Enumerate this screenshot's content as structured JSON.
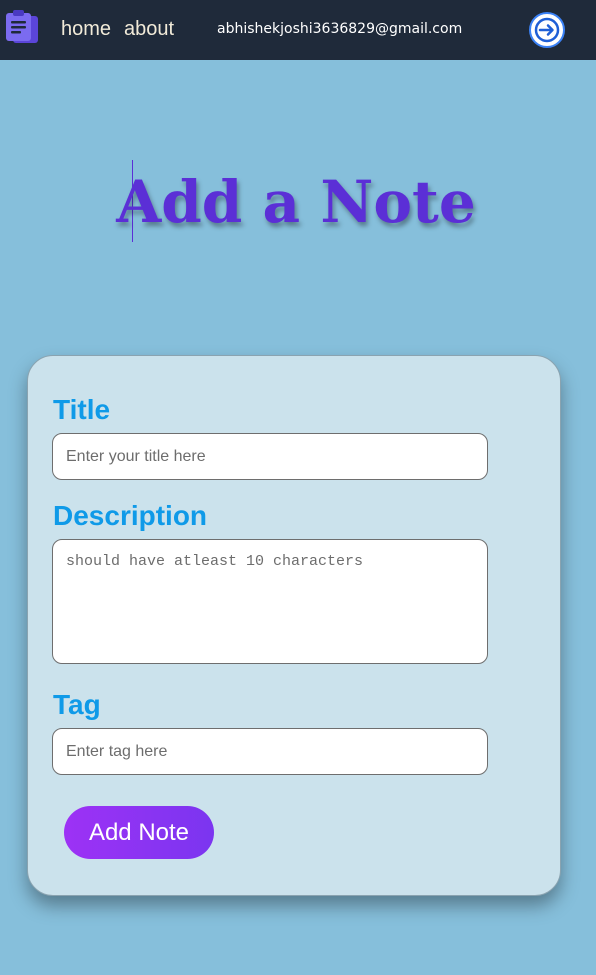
{
  "navbar": {
    "logo_icon": "notes-clipboard-icon",
    "links": [
      {
        "label": "home"
      },
      {
        "label": "about"
      }
    ],
    "user_email": "abhishekjoshi3636829@gmail.com",
    "logout_icon": "logout-arrow-icon"
  },
  "page": {
    "title": "Add a Note"
  },
  "form": {
    "title_label": "Title",
    "title_placeholder": "Enter your title here",
    "title_value": "",
    "description_label": "Description",
    "description_placeholder": "should have atleast 10 characters",
    "description_value": "",
    "tag_label": "Tag",
    "tag_placeholder": "Enter tag here",
    "tag_value": "",
    "submit_label": "Add Note"
  },
  "colors": {
    "navbar_bg": "#1f2a3a",
    "page_bg": "#86bfdb",
    "title_color": "#5b2fd6",
    "label_color": "#0f9ae8",
    "card_bg": "#cbe2ec",
    "button_gradient_start": "#9d32f5",
    "button_gradient_end": "#7b35f0"
  }
}
